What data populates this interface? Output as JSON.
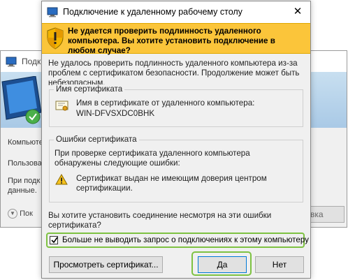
{
  "background_window": {
    "title": "Подк",
    "computer_label": "Компьютер",
    "user_label": "Пользова",
    "connect_note_line1": "При подк",
    "connect_note_line2": "данные.",
    "options_label": "Пок",
    "connect_button": "вка"
  },
  "dialog": {
    "title": "Подключение к удаленному рабочему столу",
    "close_glyph": "✕",
    "warning_banner": "Не удается проверить подлинность удаленного компьютера. Вы хотите установить подключение в любом случае?",
    "intro": "Не удалось проверить подлинность удаленного компьютера из-за проблем с сертификатом безопасности. Продолжение может быть небезопасным.",
    "cert_name_group": {
      "legend": "Имя сертификата",
      "label": "Имя в сертификате от удаленного компьютера:",
      "value": "WIN-DFVSXDC0BHK"
    },
    "cert_errors_group": {
      "legend": "Ошибки сертификата",
      "intro": "При проверке сертификата удаленного компьютера обнаружены следующие ошибки:",
      "error": "Сертификат выдан не имеющим доверия центром сертификации."
    },
    "question": "Вы хотите установить соединение несмотря на эти ошибки сертификата?",
    "dont_ask_checkbox": {
      "label": "Больше не выводить запрос о подключениях к этому компьютеру",
      "checked": true
    },
    "buttons": {
      "view_certificate": "Просмотреть сертификат...",
      "yes": "Да",
      "no": "Нет"
    }
  },
  "colors": {
    "warning_banner_bg": "#fbc53a",
    "highlight_outline": "#7ec242",
    "default_button_border": "#0078d7"
  },
  "icons": {
    "title": "remote-desktop-icon",
    "banner": "security-shield-icon",
    "certificate": "certificate-icon",
    "error": "warning-triangle-icon",
    "close": "close-icon"
  }
}
